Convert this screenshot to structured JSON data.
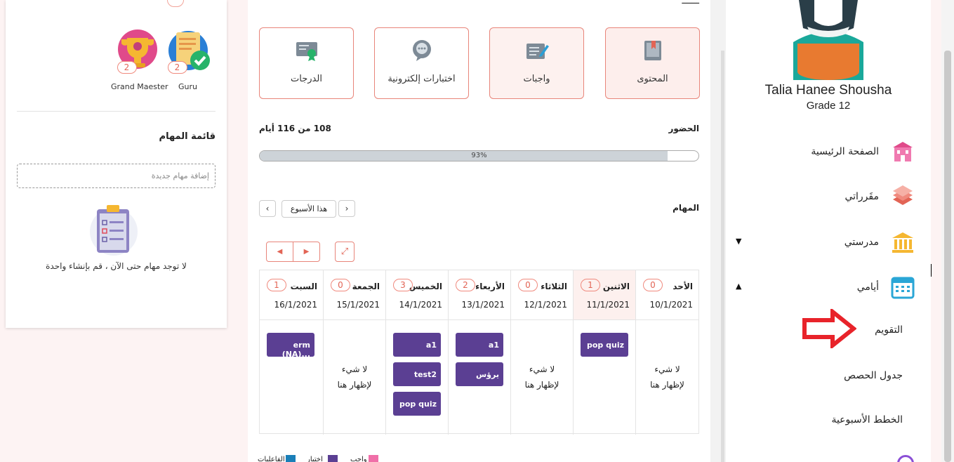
{
  "left": {
    "badges": [
      {
        "name": "Guru",
        "count": "2"
      },
      {
        "name": "Grand Maester",
        "count": "2"
      }
    ],
    "tasks_title": "قائمة المهام",
    "task_placeholder": "إضافة مهام جديدة",
    "empty_text": "لا توجد مهام حتى الآن ، قم بإنشاء واحدة"
  },
  "tiles": {
    "content": "المحتوى",
    "homework": "واجبات",
    "exams": "اختبارات إلكترونية",
    "grades": "الدرجات"
  },
  "attendance": {
    "label": "الحضور",
    "days": "108 من 116 أيام",
    "percent_text": "93%",
    "percent": 93
  },
  "tasks": {
    "label": "المهام",
    "this_week": "هذا الأسبوع",
    "prev": "‹",
    "next": "›"
  },
  "calendar": {
    "nothing": "لا شيء لإظهار هنا",
    "days": [
      {
        "name": "الأحد",
        "count": "0",
        "date": "10/1/2021",
        "items": []
      },
      {
        "name": "الاثنين",
        "count": "1",
        "date": "11/1/2021",
        "items": [
          "pop quiz"
        ]
      },
      {
        "name": "الثلاثاء",
        "count": "0",
        "date": "12/1/2021",
        "items": []
      },
      {
        "name": "الأربعاء",
        "count": "2",
        "date": "13/1/2021",
        "items": [
          "a1",
          "يرؤس"
        ]
      },
      {
        "name": "الخميس",
        "count": "3",
        "date": "14/1/2021",
        "items": [
          "a1",
          "test2",
          "pop quiz"
        ]
      },
      {
        "name": "الجمعة",
        "count": "0",
        "date": "15/1/2021",
        "items": []
      },
      {
        "name": "السبت",
        "count": "1",
        "date": "16/1/2021",
        "items": [
          "erm (NA)..."
        ]
      }
    ]
  },
  "legend": [
    {
      "label": "واجب",
      "color": "#f06fa8"
    },
    {
      "label": "اختبار",
      "color": "#5b3f93"
    },
    {
      "label": "الفاعليات",
      "color": "#1a7fb8"
    }
  ],
  "user": {
    "name": "Talia Hanee Shousha",
    "grade": "Grade 12"
  },
  "nav": {
    "home": "الصفحة الرئيسية",
    "courses": "مقَرراتي",
    "school": "مدرستي",
    "my_days": "أيامي",
    "calendar": "التقويم",
    "schedule": "جدول الحصص",
    "weekly_plans": "الخطط الأسبوعية"
  },
  "colors": {
    "accent": "#e26455",
    "event": "#5b3f93",
    "brand_teal": "#1aa89a"
  }
}
